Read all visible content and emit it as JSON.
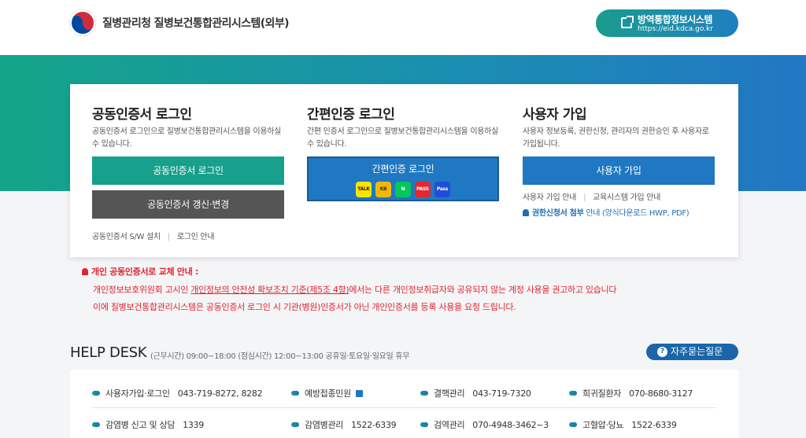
{
  "header": {
    "site_title": "질병관리청 질병보건통합관리시스템(외부)",
    "ext_button": {
      "title": "방역통합정보시스템",
      "url": "https://eid.kdca.go.kr"
    }
  },
  "login": {
    "cert": {
      "title": "공동인증서 로그인",
      "desc": "공동인증서 로그인으로 질병보건통합관리시스템을 이용하실 수 있습니다.",
      "login_button": "공동인증서 로그인",
      "renew_button": "공동인증서 갱신·변경",
      "link_install": "공동인증서 S/W 설치",
      "link_guide": "로그인 안내"
    },
    "simple": {
      "title": "간편인증 로그인",
      "desc": "간편 인증서 로그인으로 질병보건통합관리시스템을 이용하실 수 있습니다.",
      "login_button": "간편인증 로그인",
      "apps": [
        {
          "label": "TALK",
          "bg": "#f7e600",
          "fg": "#3a1d1d"
        },
        {
          "label": "KB",
          "bg": "#f5b800",
          "fg": "#333"
        },
        {
          "label": "N",
          "bg": "#03c75a",
          "fg": "#ffffff"
        },
        {
          "label": "PASS",
          "bg": "#e8262d",
          "fg": "#ffffff"
        },
        {
          "label": "Pass",
          "bg": "#1d4fd8",
          "fg": "#ffffff"
        }
      ]
    },
    "signup": {
      "title": "사용자 가입",
      "desc": "사용자 정보등록, 권한신청, 관리자의 권한승인 후 사용자로 가입됩니다.",
      "button": "사용자 가입",
      "link_guide": "사용자 가입 안내",
      "link_edu": "교육시스템 가입 안내",
      "notice_bold": "권한신청서 첨부",
      "notice_rest": " 안내 (양식다운로드 HWP, PDF)"
    }
  },
  "alert": {
    "head": "개인 공동인증서로 교체 안내 :",
    "line1_a": "개인정보보호위원회 고시인 ",
    "line1_link": "개인정보의 안전성 확보조치 기준(제5조 4항)",
    "line1_b": "에서는 다른 개인정보취급자와 공유되지 않는 계정 사용을 권고하고 있습니다",
    "line2": "이에 질병보건통합관리시스템은 공동인증서 로그인 시 기관(병원)인증서가 아닌 개인인증서를 등록 사용을 요청 드립니다."
  },
  "help": {
    "title": "HELP DESK",
    "hours": "(근무시간) 09:00~18:00 (점심시간) 12:00~13:00 공휴일·토요일·일요일 휴무",
    "faq": "자주묻는질문",
    "row1": [
      {
        "label": "사용자가입·로그인",
        "num": "043-719-8272, 8282"
      },
      {
        "label": "예방접종민원",
        "num": ""
      },
      {
        "label": "결핵관리",
        "num": "043-719-7320"
      },
      {
        "label": "희귀질환자",
        "num": "070-8680-3127"
      }
    ],
    "row2": [
      {
        "label": "감염병 신고 및 상담",
        "num": "1339"
      },
      {
        "label": "감염병관리",
        "num": "1522-6339"
      },
      {
        "label": "검역관리",
        "num": "070-4948-3462~3"
      },
      {
        "label": "고혈압·당뇨",
        "num": "1522-6339"
      }
    ]
  },
  "colors": {
    "green": "#17a08c",
    "blue": "#1f78c1",
    "red": "#e0252f"
  }
}
